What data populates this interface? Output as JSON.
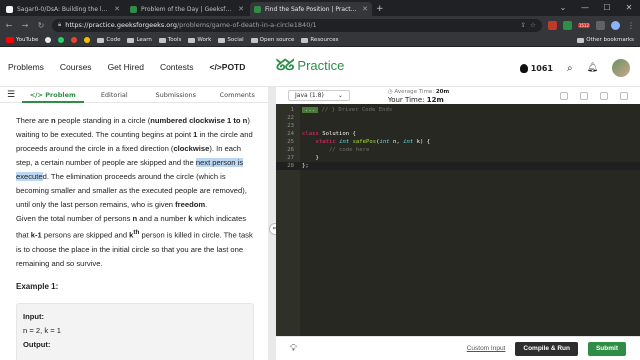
{
  "browser": {
    "tabs": [
      {
        "title": "Sagar0-0/DsA: Building the largest DS",
        "color": "#f5f5f5",
        "active": false
      },
      {
        "title": "Problem of the Day | GeeksforGeeks |",
        "color": "#2f8d46",
        "active": false
      },
      {
        "title": "Find the Safe Position | Practice |",
        "color": "#2f8d46",
        "active": true
      }
    ],
    "url_host": "https://practice.geeksforgeeks.org",
    "url_path": "/problems/game-of-death-in-a-circle1840/1",
    "ext_badge": "1512",
    "bookmarks": [
      "YouTube",
      "Code",
      "Learn",
      "Tools",
      "Work",
      "Social",
      "Open source",
      "Resources"
    ],
    "other_bookmarks": "Other bookmarks"
  },
  "header": {
    "nav": [
      "Problems",
      "Courses",
      "Get Hired",
      "Contests",
      "</>POTD"
    ],
    "logo_text": "Practice",
    "streak": "1061"
  },
  "problem_tabs": [
    "</> Problem",
    "Editorial",
    "Submissions",
    "Comments"
  ],
  "problem": {
    "p1_a": "There are ",
    "p1_b": "n",
    "p1_c": " people standing in a circle (",
    "p1_d": "numbered clockwise 1 to n",
    "p1_e": ") waiting to be executed. The counting begins at point ",
    "p1_f": "1",
    "p1_g": " in the circle and proceeds around the circle in a fixed direction (",
    "p1_h": "clockwise",
    "p1_i": "). In each step, a certain number of people are skipped and the ",
    "p1_hl": "next person is execute",
    "p1_j": "d. The elimination proceeds around the circle (which is becoming smaller and smaller as the executed people are removed), until only the last person remains, who is given ",
    "p1_k": "freedom",
    "p1_l": ".",
    "p2_a": "Given the total number of persons ",
    "p2_b": "n",
    "p2_c": " and a number ",
    "p2_d": "k",
    "p2_e": " which indicates that ",
    "p2_f": "k-1",
    "p2_g": " persons are skipped and ",
    "p2_h": "k",
    "p2_sup": "th",
    "p2_i": " person is killed in circle. The task is to choose the place in the initial circle so that you are the last one remaining and so survive.",
    "example_title": "Example 1:",
    "input_label": "Input:",
    "input_value": "n = 2, k = 1",
    "output_label": "Output:"
  },
  "editor": {
    "language": "Java (1.8)",
    "avg_time_label": "Average Time:",
    "avg_time": "20m",
    "your_time_label": "Your Time:",
    "your_time": "12m",
    "lines": [
      {
        "n": "1",
        "fold": "...",
        "code": "// } Driver Code Ends"
      },
      {
        "n": "22",
        "code": ""
      },
      {
        "n": "23",
        "code": ""
      },
      {
        "n": "24",
        "code": "class Solution {"
      },
      {
        "n": "25",
        "code": "    static int safePos(int n, int k) {"
      },
      {
        "n": "26",
        "code": "        // code here"
      },
      {
        "n": "27",
        "code": "    }"
      },
      {
        "n": "28",
        "code": "};"
      }
    ],
    "custom_input": "Custom Input",
    "compile_run": "Compile & Run",
    "submit": "Submit"
  }
}
